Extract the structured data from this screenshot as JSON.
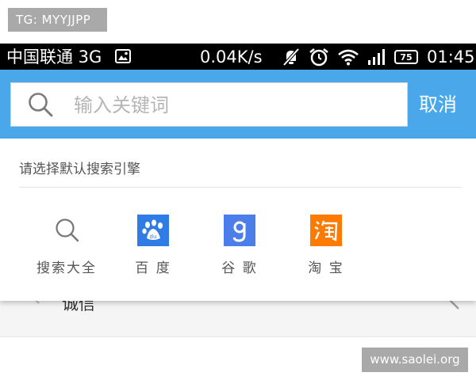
{
  "watermark_top": "TG: MYYJJPP",
  "watermark_bottom": "www.saolei.org",
  "status_bar": {
    "carrier": "中国联通 3G",
    "speed": "0.04K/s",
    "battery": "75",
    "time": "01:45",
    "icons": [
      "image-icon",
      "mute-icon",
      "alarm-icon",
      "wifi-icon",
      "signal-icon",
      "battery-icon"
    ]
  },
  "search": {
    "placeholder": "输入关键词",
    "cancel_label": "取消"
  },
  "engine_panel": {
    "title": "请选择默认搜索引擎",
    "engines": [
      {
        "label": "搜索大全",
        "icon": "search-icon"
      },
      {
        "label": "百 度",
        "icon": "baidu-icon",
        "color": "#2f7ce6"
      },
      {
        "label": "谷 歌",
        "icon": "google-icon",
        "color": "#4b7ee8"
      },
      {
        "label": "淘 宝",
        "icon": "taobao-icon",
        "color": "#ff7a00"
      }
    ]
  },
  "underlying_list": {
    "item_text": "诚信"
  },
  "colors": {
    "header_blue": "#4aa7e9",
    "status_bar": "#000000"
  }
}
